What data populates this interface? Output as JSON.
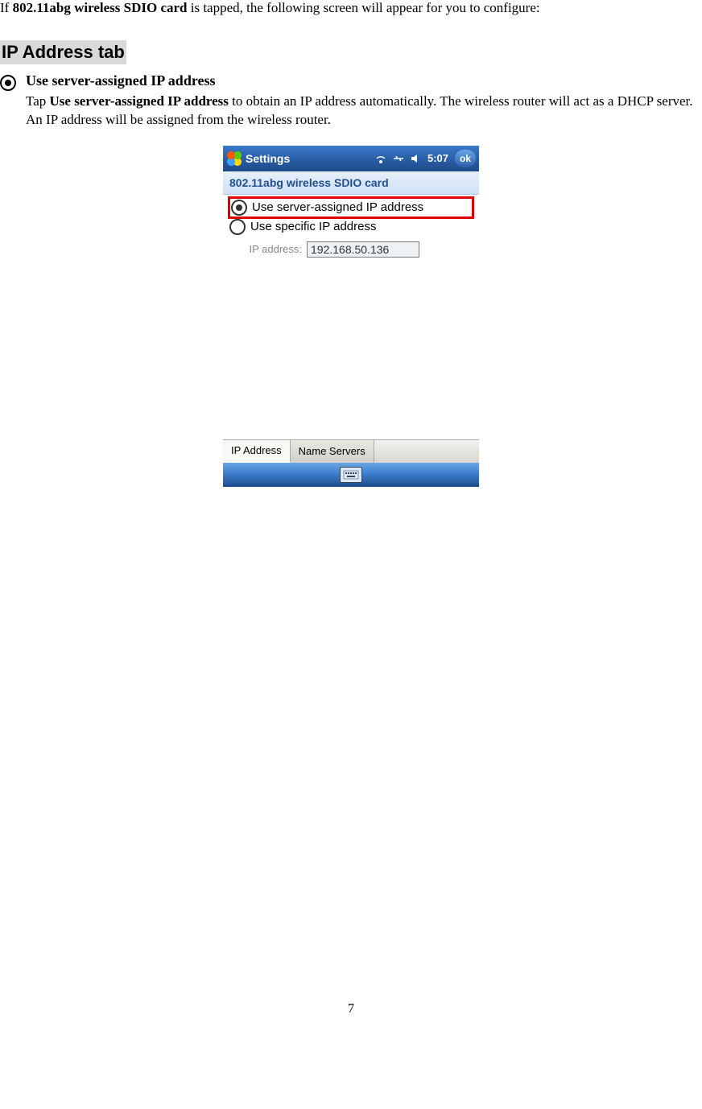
{
  "intro": {
    "prefix": "If ",
    "bold": "802.11abg wireless SDIO card",
    "suffix": " is tapped, the following screen will appear for you to configure:"
  },
  "section_heading": "IP Address tab",
  "bullet": {
    "heading": "Use server-assigned IP address",
    "body_prefix": "Tap ",
    "body_bold": "Use server-assigned IP address",
    "body_suffix": " to obtain an IP address automatically. The wireless router will act as a DHCP server. An IP address will be assigned from the wireless router."
  },
  "wm": {
    "start_label": "Settings",
    "clock": "5:07",
    "ok": "ok",
    "subtitle": "802.11abg wireless SDIO card",
    "radio_server": "Use server-assigned IP address",
    "radio_specific": "Use specific IP address",
    "ip_label": "IP address:",
    "ip_value": "192.168.50.136",
    "tabs": {
      "ip": "IP Address",
      "ns": "Name Servers"
    }
  },
  "page_number": "7"
}
